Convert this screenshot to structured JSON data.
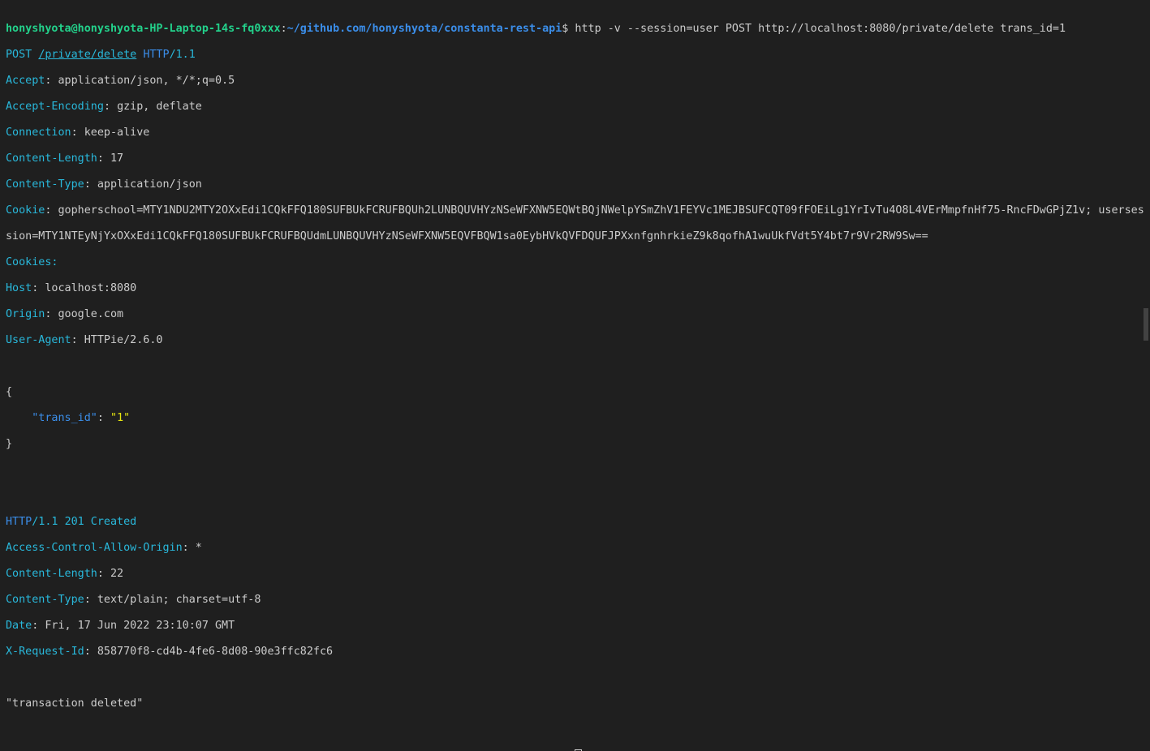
{
  "prompt": {
    "user_host": "honyshyota@honyshyota-HP-Laptop-14s-fq0xxx",
    "path": "~/github.com/honyshyota/constanta-rest-api",
    "symbol": "$",
    "command": " http -v --session=user POST http://localhost:8080/private/delete trans_id=1"
  },
  "request": {
    "method": "POST",
    "url": "/private/delete",
    "proto": "HTTP",
    "version": "/1.1",
    "headers": [
      {
        "name": "Accept",
        "value": "application/json, */*;q=0.5"
      },
      {
        "name": "Accept-Encoding",
        "value": "gzip, deflate"
      },
      {
        "name": "Connection",
        "value": "keep-alive"
      },
      {
        "name": "Content-Length",
        "value": "17"
      },
      {
        "name": "Content-Type",
        "value": "application/json"
      }
    ],
    "cookie_name": "Cookie",
    "cookie_line1": "gopherschool=MTY1NDU2MTY2OXxEdi1CQkFFQ180SUFBUkFCRUFBQUh2LUNBQUVHYzNSeWFXNW5EQWtBQjNWelpYSmZhV1FEYVc1MEJBSUFCQT09fFOEiLg1YrIvTu4O8L4VErMmpfnHf75-RncFDwGPjZ1v; userses",
    "cookie_line2": "sion=MTY1NTEyNjYxOXxEdi1CQkFFQ180SUFBUkFCRUFBQUdmLUNBQUVHYzNSeWFXNW5EQVFBQW1sa0EybHVkQVFDQUFJPXxnfgnhrkieZ9k8qofhA1wuUkfVdt5Y4bt7r9Vr2RW9Sw==",
    "cookies_label": "Cookies:",
    "headers2": [
      {
        "name": "Host",
        "value": "localhost:8080"
      },
      {
        "name": "Origin",
        "value": "google.com"
      },
      {
        "name": "User-Agent",
        "value": "HTTPie/2.6.0"
      }
    ],
    "body_open": "{",
    "body_key": "\"trans_id\"",
    "body_value": "\"1\"",
    "body_close": "}"
  },
  "response": {
    "proto": "HTTP",
    "version": "/1.1",
    "status": "201 Created",
    "headers": [
      {
        "name": "Access-Control-Allow-Origin",
        "value": "*"
      },
      {
        "name": "Content-Length",
        "value": "22"
      },
      {
        "name": "Content-Type",
        "value": "text/plain; charset=utf-8"
      },
      {
        "name": "Date",
        "value": "Fri, 17 Jun 2022 23:10:07 GMT"
      },
      {
        "name": "X-Request-Id",
        "value": "858770f8-cd4b-4fe6-8d08-90e3ffc82fc6"
      }
    ],
    "body": "\"transaction deleted\""
  }
}
